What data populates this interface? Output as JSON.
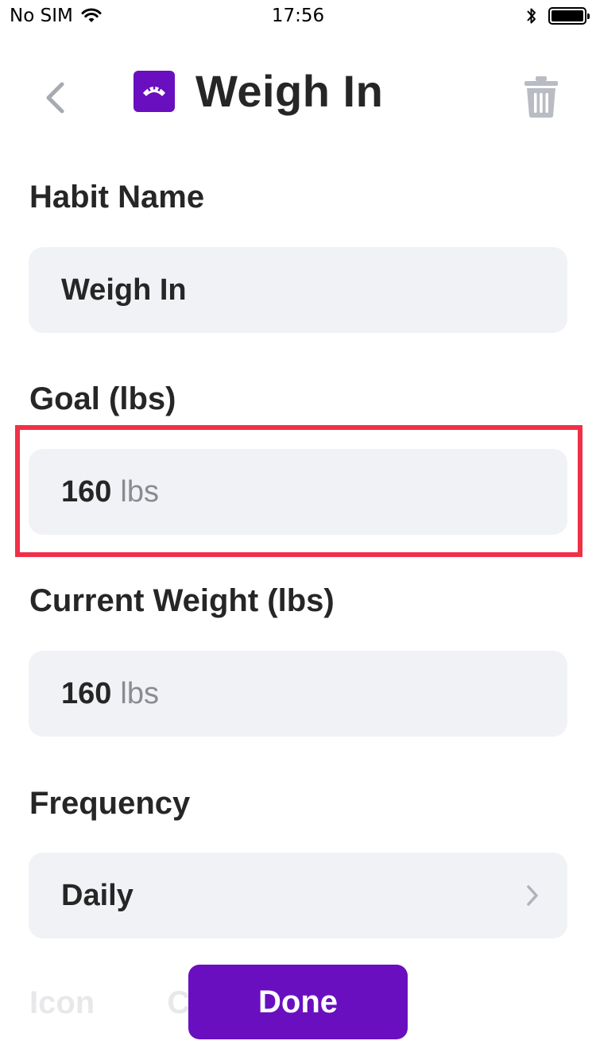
{
  "status_bar": {
    "carrier": "No SIM",
    "time": "17:56",
    "battery_level": 1.0
  },
  "header": {
    "title": "Weigh In",
    "back_icon": "chevron-left-icon",
    "habit_icon": "scale-icon",
    "delete_icon": "trash-icon"
  },
  "form": {
    "habit_name": {
      "label": "Habit Name",
      "value": "Weigh In"
    },
    "goal": {
      "label": "Goal (lbs)",
      "value": "160",
      "unit": "lbs"
    },
    "current_weight": {
      "label": "Current Weight (lbs)",
      "value": "160",
      "unit": "lbs"
    },
    "frequency": {
      "label": "Frequency",
      "value": "Daily"
    },
    "icon": {
      "label": "Icon"
    },
    "color": {
      "label": "Color"
    }
  },
  "done_button": {
    "label": "Done"
  },
  "colors": {
    "accent": "#6a0fc0",
    "field_bg": "#f1f2f6",
    "highlight": "#f03047",
    "muted_icon": "#b9bcc3"
  }
}
